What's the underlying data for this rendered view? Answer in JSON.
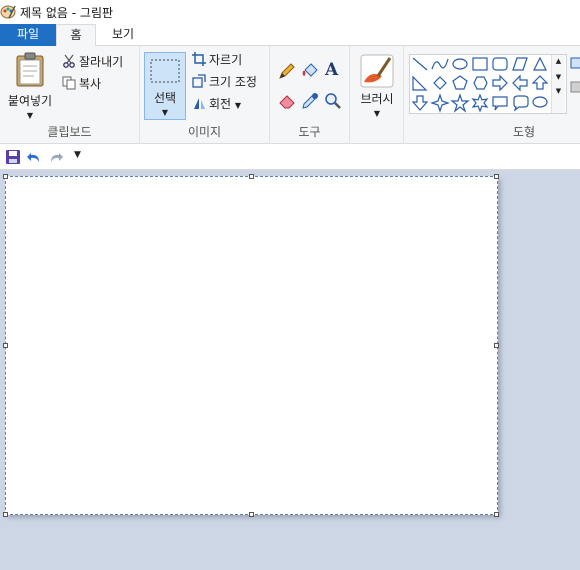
{
  "window": {
    "title": "제목 없음 - 그림판"
  },
  "tabs": {
    "file": "파일",
    "home": "홈",
    "view": "보기"
  },
  "clipboard": {
    "paste": "붙여넣기",
    "cut": "잘라내기",
    "copy": "복사",
    "label": "클립보드"
  },
  "image": {
    "select": "선택",
    "crop": "자르기",
    "resize": "크기 조정",
    "rotate": "회전",
    "label": "이미지"
  },
  "tools": {
    "label": "도구"
  },
  "brushes": {
    "label": "브러시"
  },
  "shapes": {
    "label": "도형"
  },
  "colors": {
    "accent": "#1e6fc4",
    "canvas_bg": "#cdd6e4"
  }
}
